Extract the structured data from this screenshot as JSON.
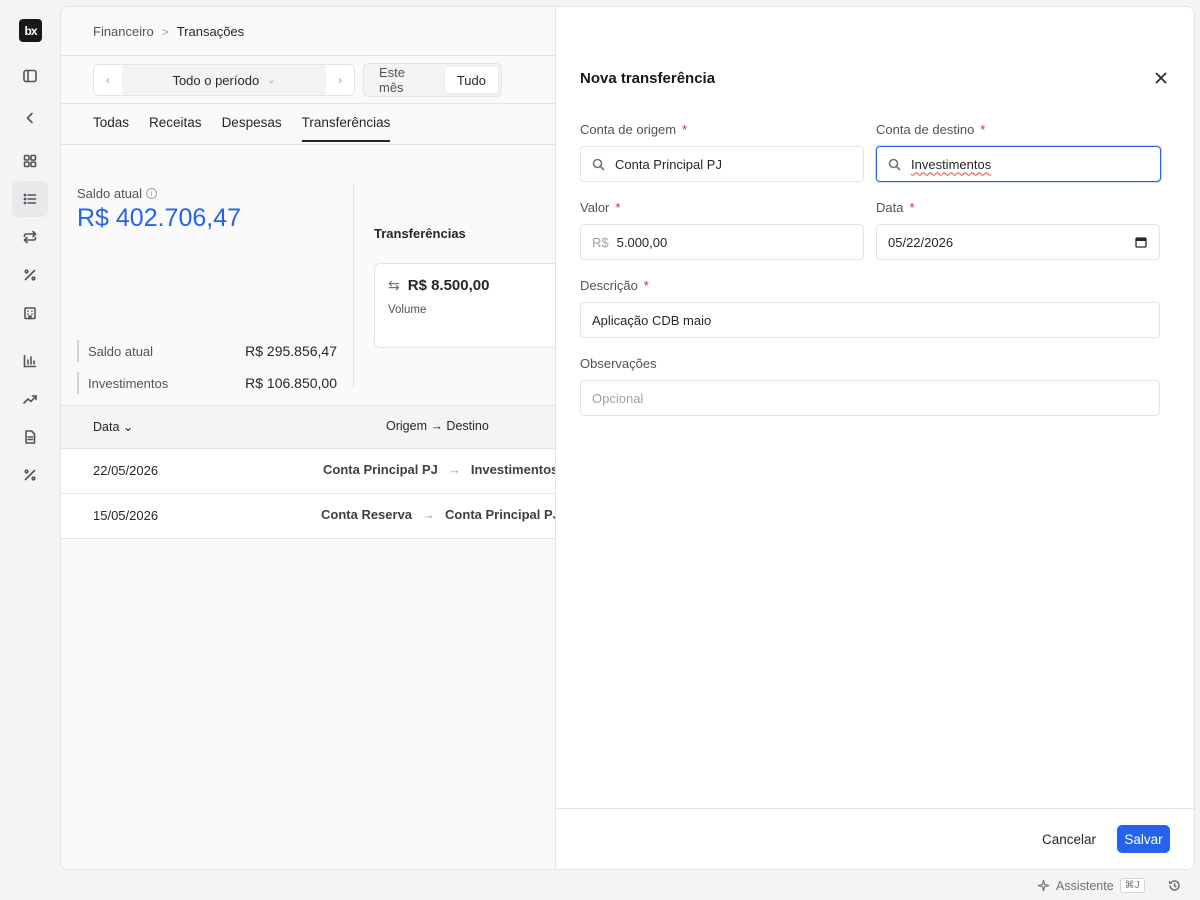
{
  "logo": "bx",
  "breadcrumb": {
    "parent": "Financeiro",
    "sep": ">",
    "current": "Transações"
  },
  "period": {
    "prev": "‹",
    "label": "Todo o período",
    "chev": "⌄",
    "next": "›"
  },
  "segment": {
    "month": "Este mês",
    "all": "Tudo"
  },
  "tabs": [
    "Todas",
    "Receitas",
    "Despesas",
    "Transferências"
  ],
  "balance": {
    "label": "Saldo atual",
    "info": "i",
    "value": "R$ 402.706,47",
    "accounts": [
      {
        "name": "Saldo atual",
        "value": "R$ 295.856,47"
      },
      {
        "name": "Investimentos",
        "value": "R$ 106.850,00"
      }
    ]
  },
  "transfers": {
    "title": "Transferências",
    "icon": "⇆",
    "amount": "R$ 8.500,00",
    "sub": "Volume"
  },
  "table": {
    "col_date": "Data ⌄",
    "col_route": "Origem → Destino",
    "arrow": "→",
    "rows": [
      {
        "date": "22/05/2026",
        "from": "Conta Principal PJ",
        "to": "Investimentos"
      },
      {
        "date": "15/05/2026",
        "from": "Conta Reserva",
        "to": "Conta Principal PJ"
      }
    ]
  },
  "drawer": {
    "title": "Nova transferência",
    "required_mark": "*",
    "origin_label": "Conta de origem",
    "origin_value": "Conta Principal PJ",
    "dest_label": "Conta de destino",
    "dest_value": "Investimentos",
    "amount_label": "Valor",
    "amount_prefix": "R$",
    "amount_value": "5.000,00",
    "date_label": "Data",
    "date_value": "05/22/2026",
    "desc_label": "Descrição",
    "desc_value": "Aplicação CDB maio",
    "notes_label": "Observações",
    "notes_placeholder": "Opcional",
    "cancel": "Cancelar",
    "save": "Salvar"
  },
  "assistant": {
    "label": "Assistente",
    "shortcut": "⌘J"
  },
  "colors": {
    "accent": "#2563eb",
    "required": "#dc2626"
  }
}
